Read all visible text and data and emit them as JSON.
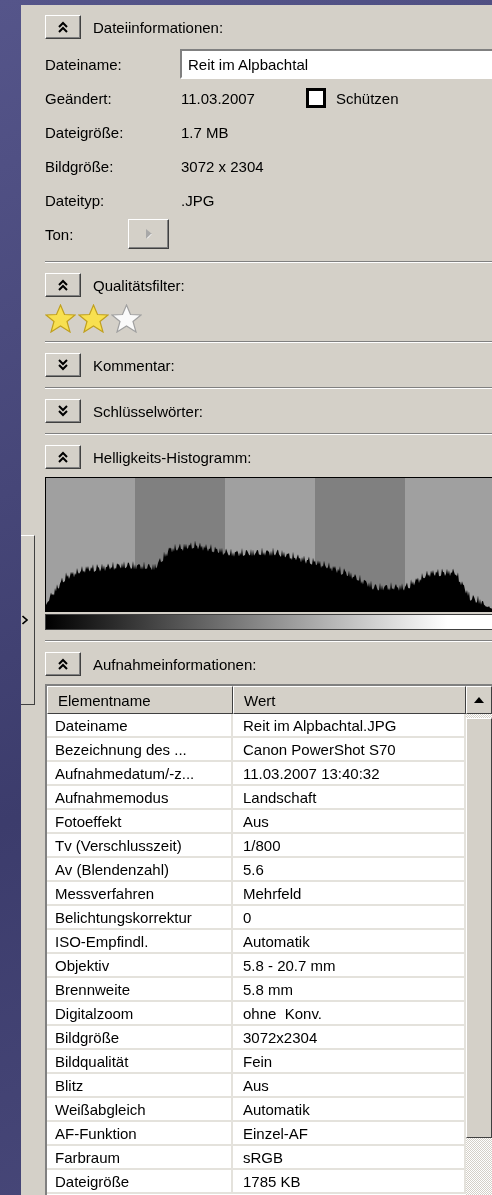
{
  "sections": [
    {
      "kind": "file_info",
      "title": "Dateiinformationen:",
      "expanded": true,
      "fields": [
        {
          "kind": "input",
          "label": "Dateiname:",
          "value": "Reit im Alpbachtal"
        },
        {
          "kind": "text",
          "label": "Geändert:",
          "value": "11.03.2007",
          "checkbox": {
            "label": "Schützen",
            "checked": false
          }
        },
        {
          "kind": "text",
          "label": "Dateigröße:",
          "value": "1.7 MB"
        },
        {
          "kind": "text",
          "label": "Bildgröße:",
          "value": "3072 x 2304"
        },
        {
          "kind": "text",
          "label": "Dateityp:",
          "value": ".JPG"
        },
        {
          "kind": "play_button",
          "label": "Ton:",
          "disabled": true
        }
      ]
    },
    {
      "kind": "rating",
      "title": "Qualitätsfilter:",
      "expanded": true,
      "stars": 2
    },
    {
      "title": "Kommentar:",
      "expanded": false
    },
    {
      "title": "Schlüsselwörter:",
      "expanded": false
    },
    {
      "kind": "histogram",
      "title": "Helligkeits-Histogramm:",
      "expanded": true
    },
    {
      "kind": "table",
      "title": "Aufnahmeinformationen:",
      "expanded": true,
      "columns": [
        "Elementname",
        "Wert"
      ],
      "rows": [
        [
          "Dateiname",
          "Reit im Alpbachtal.JPG"
        ],
        [
          "Bezeichnung des ...",
          "Canon PowerShot S70"
        ],
        [
          "Aufnahmedatum/-z...",
          "11.03.2007 13:40:32"
        ],
        [
          "Aufnahmemodus",
          "Landschaft"
        ],
        [
          "Fotoeffekt",
          "Aus"
        ],
        [
          "Tv (Verschlusszeit)",
          "1/800"
        ],
        [
          "Av (Blendenzahl)",
          "5.6"
        ],
        [
          "Messverfahren",
          "Mehrfeld"
        ],
        [
          "Belichtungskorrektur",
          "0"
        ],
        [
          "ISO-Empfindl.",
          "Automatik"
        ],
        [
          "Objektiv",
          "5.8 - 20.7 mm"
        ],
        [
          "Brennweite",
          "5.8 mm"
        ],
        [
          "Digitalzoom",
          "ohne  Konv."
        ],
        [
          "Bildgröße",
          "3072x2304"
        ],
        [
          "Bildqualität",
          "Fein"
        ],
        [
          "Blitz",
          "Aus"
        ],
        [
          "Weißabgleich",
          "Automatik"
        ],
        [
          "AF-Funktion",
          "Einzel-AF"
        ],
        [
          "Farbraum",
          "sRGB"
        ],
        [
          "Dateigröße",
          "1785 KB"
        ]
      ]
    }
  ]
}
